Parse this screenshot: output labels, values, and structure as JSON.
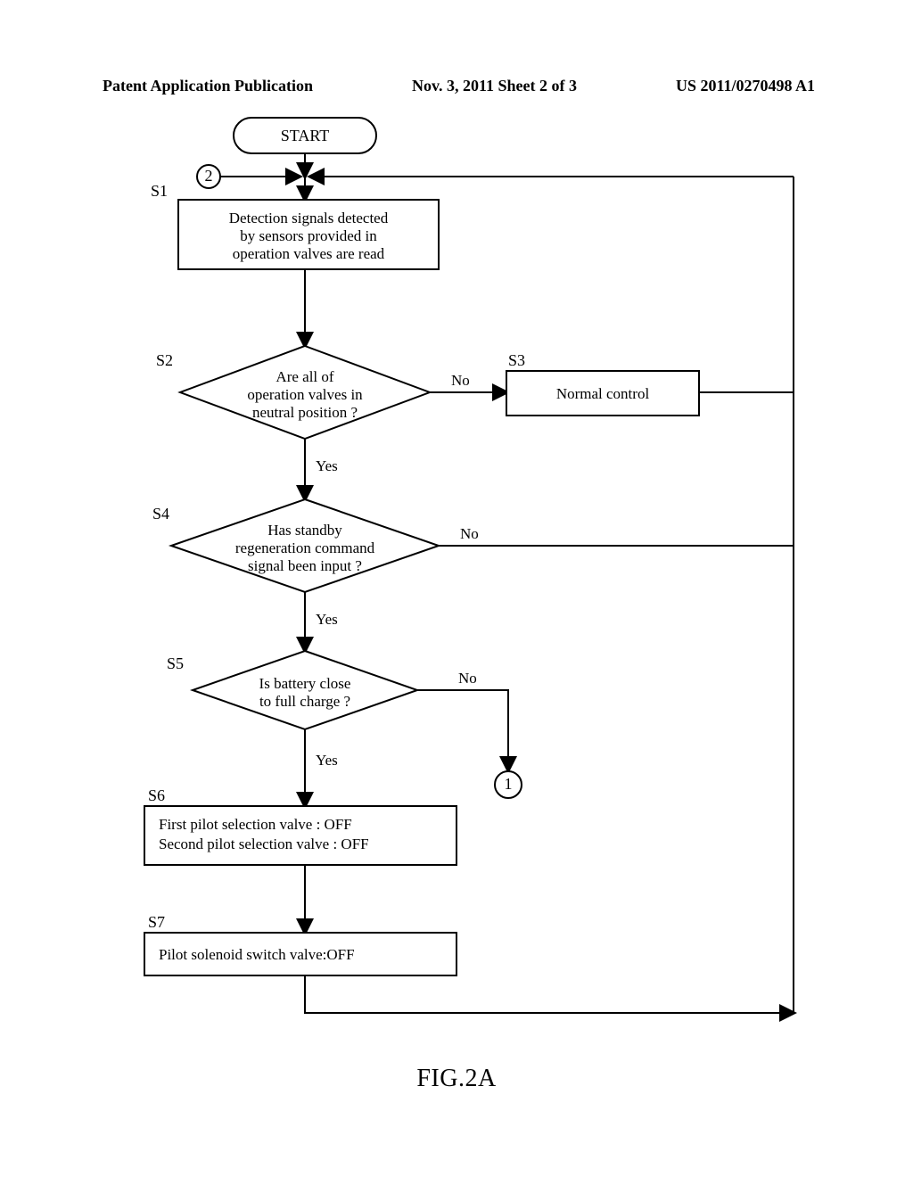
{
  "header": {
    "left": "Patent Application Publication",
    "center": "Nov. 3, 2011  Sheet 2 of 3",
    "right": "US 2011/0270498 A1"
  },
  "figure_caption": "FIG.2A",
  "flow": {
    "start": "START",
    "s1_label": "S1",
    "s1_line1": "Detection signals detected",
    "s1_line2": "by sensors provided in",
    "s1_line3": "operation valves are read",
    "s2_label": "S2",
    "s2_line1": "Are all of",
    "s2_line2": "operation valves in",
    "s2_line3": "neutral position ?",
    "s2_no": "No",
    "s2_yes": "Yes",
    "s3_label": "S3",
    "s3_text": "Normal control",
    "s4_label": "S4",
    "s4_line1": "Has standby",
    "s4_line2": "regeneration command",
    "s4_line3": "signal been input ?",
    "s4_no": "No",
    "s4_yes": "Yes",
    "s5_label": "S5",
    "s5_line1": "Is battery close",
    "s5_line2": "to full charge ?",
    "s5_no": "No",
    "s5_yes": "Yes",
    "s6_label": "S6",
    "s6_line1": "First pilot selection valve : OFF",
    "s6_line2": "Second pilot selection valve : OFF",
    "s7_label": "S7",
    "s7_text": "Pilot solenoid switch valve:OFF",
    "connector1": "1",
    "connector2": "2"
  }
}
